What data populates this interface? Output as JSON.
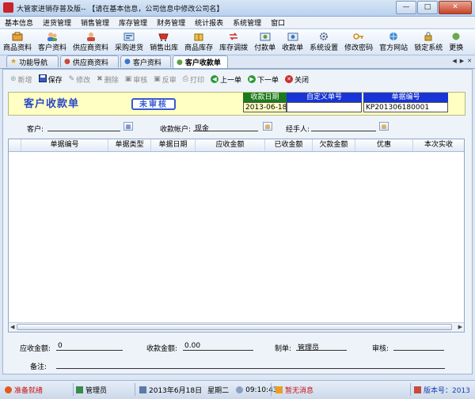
{
  "window": {
    "title": "大管家进销存普及版-- 【请在基本信息，公司信息中修改公司名】",
    "minimize": "—",
    "maximize": "□",
    "close": "✕"
  },
  "menu": [
    "基本信息",
    "进货管理",
    "销售管理",
    "库存管理",
    "财务管理",
    "统计报表",
    "系统管理",
    "窗口"
  ],
  "toolbar": [
    {
      "label": "商品资料",
      "icon": "goods-icon"
    },
    {
      "label": "客户资料",
      "icon": "customer-icon"
    },
    {
      "label": "供应商资料",
      "icon": "supplier-icon"
    },
    {
      "label": "采购进货",
      "icon": "purchase-icon"
    },
    {
      "label": "销售出库",
      "icon": "sales-icon"
    },
    {
      "label": "商品库存",
      "icon": "stock-icon"
    },
    {
      "label": "库存调拨",
      "icon": "transfer-icon"
    },
    {
      "label": "付款单",
      "icon": "payment-icon"
    },
    {
      "label": "收款单",
      "icon": "receipt-icon"
    },
    {
      "label": "系统设置",
      "icon": "settings-icon"
    },
    {
      "label": "修改密码",
      "icon": "password-icon"
    },
    {
      "label": "官方网站",
      "icon": "website-icon"
    },
    {
      "label": "锁定系统",
      "icon": "lock-icon"
    },
    {
      "label": "更换",
      "icon": "switch-icon"
    }
  ],
  "tabs": [
    {
      "label": "功能导航",
      "active": false
    },
    {
      "label": "供应商资料",
      "active": false
    },
    {
      "label": "客户资料",
      "active": false
    },
    {
      "label": "客户收款单",
      "active": true
    }
  ],
  "actions": [
    {
      "label": "新增",
      "enabled": false
    },
    {
      "label": "保存",
      "enabled": true
    },
    {
      "label": "修改",
      "enabled": false
    },
    {
      "label": "删除",
      "enabled": false
    },
    {
      "label": "审核",
      "enabled": false
    },
    {
      "label": "反审",
      "enabled": false
    },
    {
      "label": "打印",
      "enabled": false
    },
    {
      "label": "上一单",
      "enabled": true
    },
    {
      "label": "下一单",
      "enabled": true
    },
    {
      "label": "关闭",
      "enabled": true
    }
  ],
  "document": {
    "title": "客户收款单",
    "status_stamp": "未审核",
    "date_header": "收款日期",
    "date_value": "2013-06-18",
    "custom_no_header": "自定义单号",
    "custom_no_value": "",
    "doc_no_header": "单据编号",
    "doc_no_value": "KP201306180001"
  },
  "form": {
    "customer_label": "客户:",
    "customer_value": "",
    "account_label": "收款帐户:",
    "account_value": "现金",
    "handler_label": "经手人:",
    "handler_value": ""
  },
  "table": {
    "columns": [
      "单据编号",
      "单据类型",
      "单据日期",
      "应收金额",
      "已收金额",
      "欠款金额",
      "优惠",
      "本次实收"
    ],
    "rows": []
  },
  "summary": {
    "receivable_label": "应收金额:",
    "receivable_value": "0",
    "received_label": "收款金额:",
    "received_value": "0.00",
    "maker_label": "制单:",
    "maker_value": "管理员",
    "auditor_label": "审核:",
    "auditor_value": "",
    "remark_label": "备注:",
    "remark_value": ""
  },
  "status": {
    "ready": "准备就绪",
    "user": "管理员",
    "date": "2013年6月18日",
    "weekday": "星期二",
    "time": "09:10:43",
    "messages": "暂无消息",
    "version": "版本号：2013"
  },
  "colors": {
    "doc_title": "#2a49c6",
    "date_header_bg": "#1c7a1c",
    "other_header_bg": "#1834d6",
    "header_band": "#ffffc4",
    "status_ready": "#cc1111",
    "version": "#1a3fb0"
  }
}
